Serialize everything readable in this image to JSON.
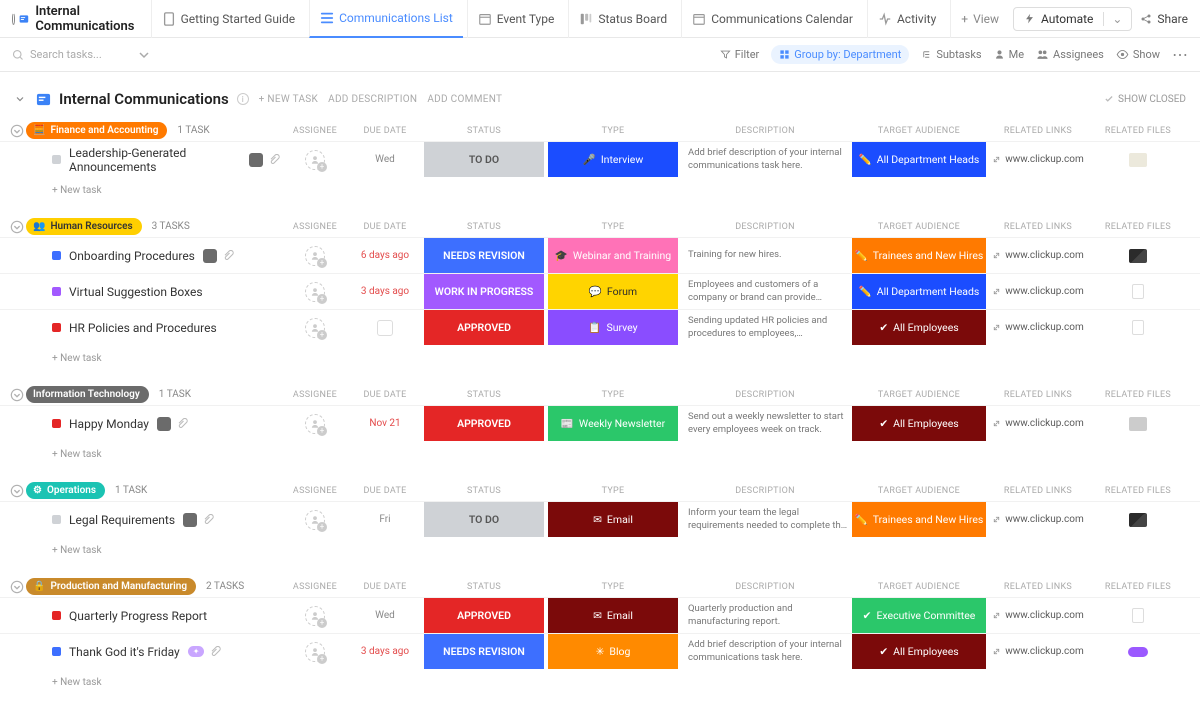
{
  "header": {
    "title": "Internal Communications",
    "tabs": [
      {
        "label": "Getting Started Guide"
      },
      {
        "label": "Communications List"
      },
      {
        "label": "Event Type"
      },
      {
        "label": "Status Board"
      },
      {
        "label": "Communications Calendar"
      },
      {
        "label": "Activity"
      }
    ],
    "add_view": "View",
    "automate": "Automate",
    "share": "Share"
  },
  "toolbar": {
    "search_placeholder": "Search tasks...",
    "filter": "Filter",
    "group_by": "Group by: Department",
    "subtasks": "Subtasks",
    "me": "Me",
    "assignees": "Assignees",
    "show": "Show"
  },
  "list_header": {
    "title": "Internal Communications",
    "new_task": "+ NEW TASK",
    "add_description": "ADD DESCRIPTION",
    "add_comment": "ADD COMMENT",
    "show_closed": "SHOW CLOSED"
  },
  "columns": {
    "assignee": "ASSIGNEE",
    "due": "DUE DATE",
    "status": "STATUS",
    "type": "TYPE",
    "description": "DESCRIPTION",
    "audience": "TARGET AUDIENCE",
    "links": "RELATED LINKS",
    "files": "RELATED FILES"
  },
  "link_text": "www.clickup.com",
  "new_task_label": "+ New task",
  "groups": [
    {
      "name": "Finance and Accounting",
      "chip_class": "chip-orange",
      "icon": "🧮",
      "count": "1 TASK",
      "tasks": [
        {
          "title": "Leadership-Generated Announcements",
          "sq": "#cfd2d6",
          "due": "Wed",
          "due_class": "due-grey",
          "status": "TO DO",
          "status_class": "st-todo",
          "type": "Interview",
          "type_icon": "🎤",
          "type_class": "ty-interview",
          "desc": "Add brief description of your internal communications task here.",
          "audience": "All Department Heads",
          "aud_icon": "✏️",
          "aud_class": "au-blue",
          "file": "light",
          "extra": [
            "avatar",
            "attach"
          ]
        }
      ]
    },
    {
      "name": "Human Resources",
      "chip_class": "chip-yellow",
      "icon": "👥",
      "count": "3 TASKS",
      "tasks": [
        {
          "title": "Onboarding Procedures",
          "sq": "#3d6fff",
          "due": "6 days ago",
          "due_class": "due-red",
          "status": "NEEDS REVISION",
          "status_class": "st-needs",
          "type": "Webinar and Training",
          "type_icon": "🎓",
          "type_class": "ty-webinar",
          "desc": "Training for new hires.",
          "audience": "Trainees and New Hires",
          "aud_icon": "✏️",
          "aud_class": "au-orange",
          "file": "dark",
          "extra": [
            "avatar",
            "attach"
          ]
        },
        {
          "title": "Virtual Suggestion Boxes",
          "sq": "#a259ff",
          "due": "3 days ago",
          "due_class": "due-red",
          "status": "WORK IN PROGRESS",
          "status_class": "st-wip",
          "type": "Forum",
          "type_icon": "💬",
          "type_class": "ty-forum",
          "desc": "Employees and customers of a company or brand can provide feedback or comments …",
          "audience": "All Department Heads",
          "aud_icon": "✏️",
          "aud_class": "au-blue",
          "file": "page",
          "extra": []
        },
        {
          "title": "HR Policies and Procedures",
          "sq": "#e42626",
          "due": "",
          "due_class": "",
          "status": "APPROVED",
          "status_class": "st-approved",
          "type": "Survey",
          "type_icon": "📋",
          "type_class": "ty-survey",
          "desc": "Sending updated HR policies and procedures to employees, supervisors, and anyone with re-…",
          "audience": "All Employees",
          "aud_icon": "✔",
          "aud_class": "au-dark",
          "file": "page",
          "extra": []
        }
      ]
    },
    {
      "name": "Information Technology",
      "chip_class": "chip-grey",
      "icon": "",
      "count": "1 TASK",
      "tasks": [
        {
          "title": "Happy Monday",
          "sq": "#e42626",
          "due": "Nov 21",
          "due_class": "due-red",
          "status": "APPROVED",
          "status_class": "st-approved",
          "type": "Weekly Newsletter",
          "type_icon": "📰",
          "type_class": "ty-news",
          "desc": "Send out a weekly newsletter to start every employees week on track.",
          "audience": "All Employees",
          "aud_icon": "✔",
          "aud_class": "au-dark",
          "file": "thumb",
          "extra": [
            "avatar",
            "attach"
          ]
        }
      ]
    },
    {
      "name": "Operations",
      "chip_class": "chip-teal",
      "icon": "⚙",
      "count": "1 TASK",
      "tasks": [
        {
          "title": "Legal Requirements",
          "sq": "#cfd2d6",
          "due": "Fri",
          "due_class": "due-grey",
          "status": "TO DO",
          "status_class": "st-todo",
          "type": "Email",
          "type_icon": "✉",
          "type_class": "ty-email",
          "desc": "Inform your team the legal requirements needed to complete the proposed project.",
          "audience": "Trainees and New Hires",
          "aud_icon": "✏️",
          "aud_class": "au-orange",
          "file": "dark",
          "extra": [
            "avatar",
            "attach"
          ]
        }
      ]
    },
    {
      "name": "Production and Manufacturing",
      "chip_class": "chip-brown",
      "icon": "🔒",
      "count": "2 TASKS",
      "tasks": [
        {
          "title": "Quarterly Progress Report",
          "sq": "#e42626",
          "due": "Wed",
          "due_class": "due-grey",
          "status": "APPROVED",
          "status_class": "st-approved",
          "type": "Email",
          "type_icon": "✉",
          "type_class": "ty-email",
          "desc": "Quarterly production and manufacturing report.",
          "audience": "Executive Committee",
          "aud_icon": "✔",
          "aud_class": "au-green",
          "file": "page",
          "extra": []
        },
        {
          "title": "Thank God it's Friday",
          "sq": "#3d6fff",
          "due": "3 days ago",
          "due_class": "due-red",
          "status": "NEEDS REVISION",
          "status_class": "st-needs",
          "type": "Blog",
          "type_icon": "✳",
          "type_class": "ty-blog",
          "desc": "Add brief description of your internal communications task here.",
          "audience": "All Employees",
          "aud_icon": "✔",
          "aud_class": "au-dark",
          "file": "purple",
          "extra": [
            "tag",
            "attach"
          ]
        }
      ]
    }
  ]
}
